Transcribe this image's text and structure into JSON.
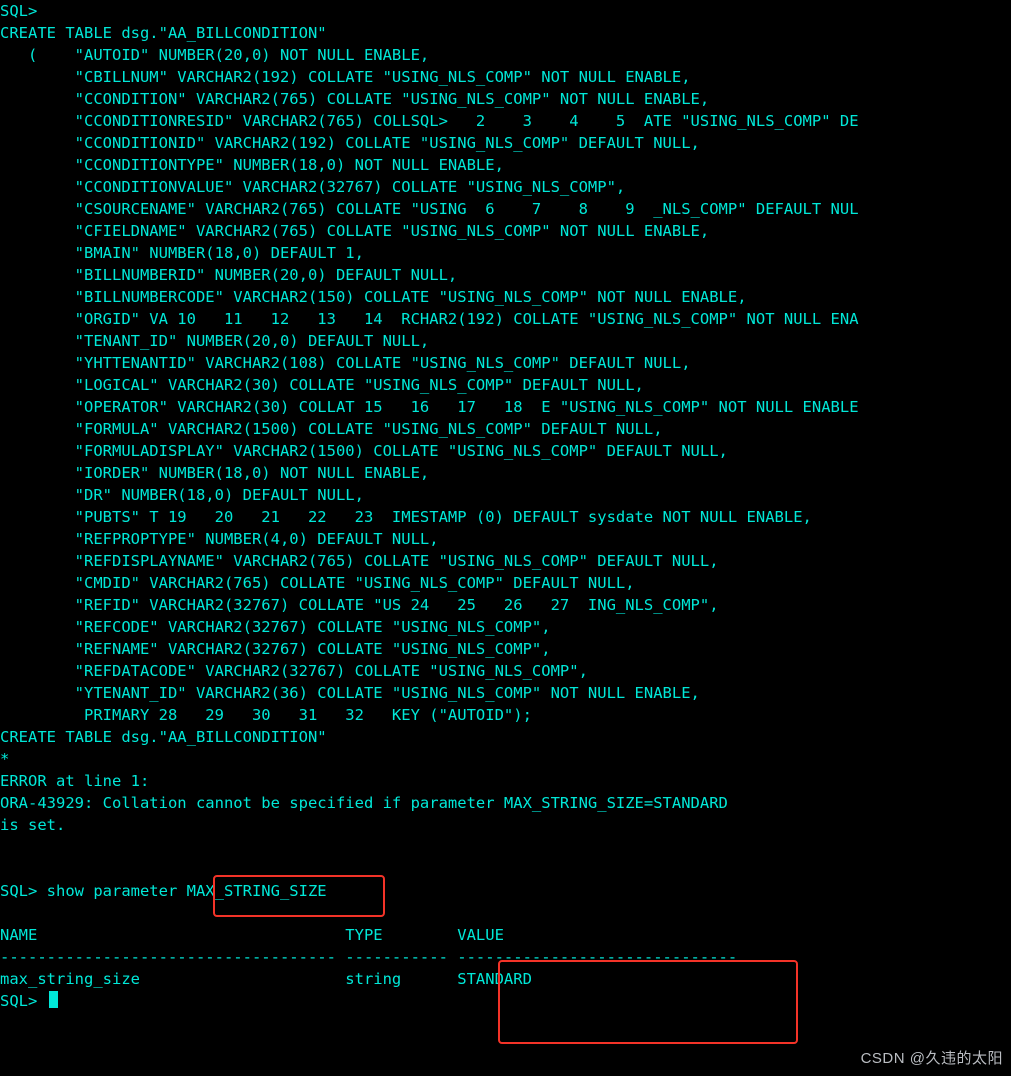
{
  "terminal": {
    "lines": [
      "SQL>",
      "CREATE TABLE dsg.\"AA_BILLCONDITION\"",
      "   (    \"AUTOID\" NUMBER(20,0) NOT NULL ENABLE,",
      "        \"CBILLNUM\" VARCHAR2(192) COLLATE \"USING_NLS_COMP\" NOT NULL ENABLE,",
      "        \"CCONDITION\" VARCHAR2(765) COLLATE \"USING_NLS_COMP\" NOT NULL ENABLE,",
      "        \"CCONDITIONRESID\" VARCHAR2(765) COLLSQL>   2    3    4    5  ATE \"USING_NLS_COMP\" DE",
      "        \"CCONDITIONID\" VARCHAR2(192) COLLATE \"USING_NLS_COMP\" DEFAULT NULL,",
      "        \"CCONDITIONTYPE\" NUMBER(18,0) NOT NULL ENABLE,",
      "        \"CCONDITIONVALUE\" VARCHAR2(32767) COLLATE \"USING_NLS_COMP\",",
      "        \"CSOURCENAME\" VARCHAR2(765) COLLATE \"USING  6    7    8    9  _NLS_COMP\" DEFAULT NUL",
      "        \"CFIELDNAME\" VARCHAR2(765) COLLATE \"USING_NLS_COMP\" NOT NULL ENABLE,",
      "        \"BMAIN\" NUMBER(18,0) DEFAULT 1,",
      "        \"BILLNUMBERID\" NUMBER(20,0) DEFAULT NULL,",
      "        \"BILLNUMBERCODE\" VARCHAR2(150) COLLATE \"USING_NLS_COMP\" NOT NULL ENABLE,",
      "        \"ORGID\" VA 10   11   12   13   14  RCHAR2(192) COLLATE \"USING_NLS_COMP\" NOT NULL ENA",
      "        \"TENANT_ID\" NUMBER(20,0) DEFAULT NULL,",
      "        \"YHTTENANTID\" VARCHAR2(108) COLLATE \"USING_NLS_COMP\" DEFAULT NULL,",
      "        \"LOGICAL\" VARCHAR2(30) COLLATE \"USING_NLS_COMP\" DEFAULT NULL,",
      "        \"OPERATOR\" VARCHAR2(30) COLLAT 15   16   17   18  E \"USING_NLS_COMP\" NOT NULL ENABLE",
      "        \"FORMULA\" VARCHAR2(1500) COLLATE \"USING_NLS_COMP\" DEFAULT NULL,",
      "        \"FORMULADISPLAY\" VARCHAR2(1500) COLLATE \"USING_NLS_COMP\" DEFAULT NULL,",
      "        \"IORDER\" NUMBER(18,0) NOT NULL ENABLE,",
      "        \"DR\" NUMBER(18,0) DEFAULT NULL,",
      "        \"PUBTS\" T 19   20   21   22   23  IMESTAMP (0) DEFAULT sysdate NOT NULL ENABLE,",
      "        \"REFPROPTYPE\" NUMBER(4,0) DEFAULT NULL,",
      "        \"REFDISPLAYNAME\" VARCHAR2(765) COLLATE \"USING_NLS_COMP\" DEFAULT NULL,",
      "        \"CMDID\" VARCHAR2(765) COLLATE \"USING_NLS_COMP\" DEFAULT NULL,",
      "        \"REFID\" VARCHAR2(32767) COLLATE \"US 24   25   26   27  ING_NLS_COMP\",",
      "        \"REFCODE\" VARCHAR2(32767) COLLATE \"USING_NLS_COMP\",",
      "        \"REFNAME\" VARCHAR2(32767) COLLATE \"USING_NLS_COMP\",",
      "        \"REFDATACODE\" VARCHAR2(32767) COLLATE \"USING_NLS_COMP\",",
      "        \"YTENANT_ID\" VARCHAR2(36) COLLATE \"USING_NLS_COMP\" NOT NULL ENABLE,",
      "         PRIMARY 28   29   30   31   32   KEY (\"AUTOID\");",
      "CREATE TABLE dsg.\"AA_BILLCONDITION\"",
      "*",
      "ERROR at line 1:",
      "ORA-43929: Collation cannot be specified if parameter MAX_STRING_SIZE=STANDARD",
      "is set.",
      "",
      "",
      "SQL> show parameter MAX_STRING_SIZE",
      "",
      "NAME                                 TYPE        VALUE",
      "------------------------------------ ----------- ------------------------------",
      "max_string_size                      string      STANDARD",
      "SQL> "
    ],
    "cursor_after_line": 45
  },
  "highlights": {
    "box1": "MAX_STRING_SIZE",
    "box2_header": "VALUE",
    "box2_value": "STANDARD"
  },
  "watermark": "CSDN @久违的太阳"
}
